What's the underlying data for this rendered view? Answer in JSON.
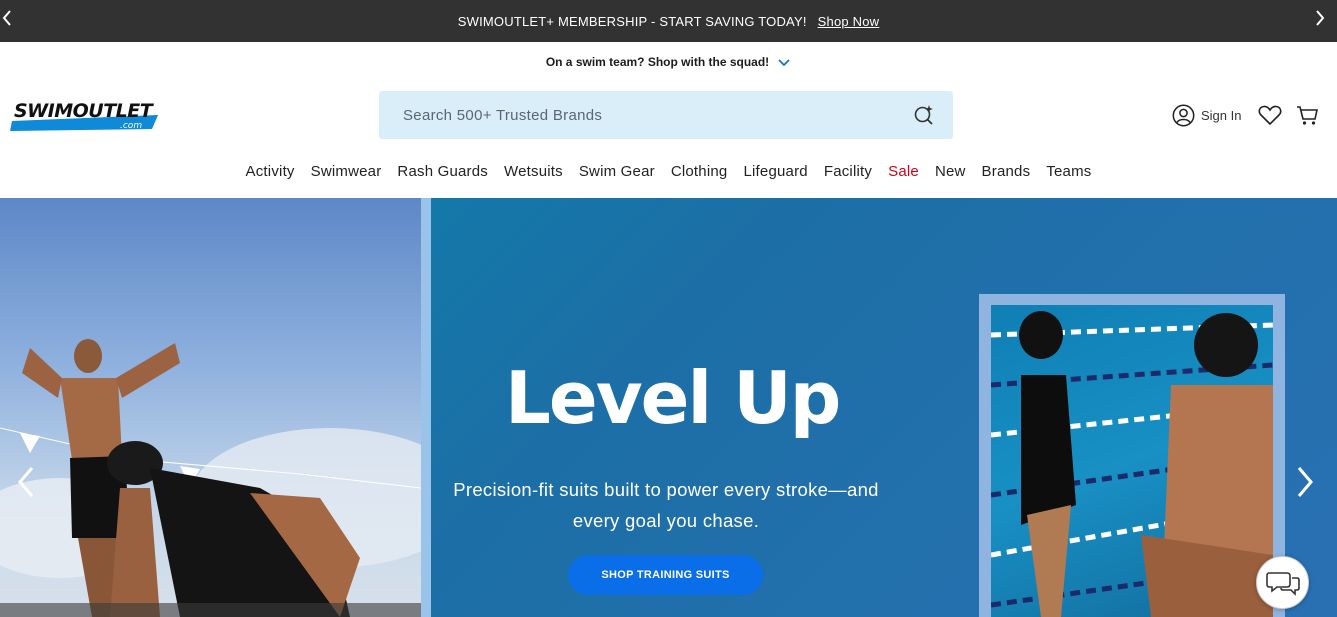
{
  "promo": {
    "message": "SWIMOUTLET+ MEMBERSHIP - START SAVING TODAY!",
    "link": "Shop Now",
    "prev_icon": "chevron-left-icon",
    "next_icon": "chevron-right-icon"
  },
  "team_bar": {
    "text": "On a swim team? Shop with the squad!",
    "icon": "chevron-down-icon",
    "accent": "#1a6fd6"
  },
  "header": {
    "logo_main": "SWIMOUTLET",
    "logo_sub": ".com",
    "search_placeholder": "Search 500+ Trusted Brands",
    "search_icon": "search-sparkle-icon",
    "sign_in": "Sign In",
    "account_icon": "user-icon",
    "wishlist_icon": "heart-icon",
    "cart_icon": "cart-icon"
  },
  "nav": {
    "items": [
      {
        "label": "Activity"
      },
      {
        "label": "Swimwear"
      },
      {
        "label": "Rash Guards"
      },
      {
        "label": "Wetsuits"
      },
      {
        "label": "Swim Gear"
      },
      {
        "label": "Clothing"
      },
      {
        "label": "Lifeguard"
      },
      {
        "label": "Facility"
      },
      {
        "label": "Sale"
      },
      {
        "label": "New"
      },
      {
        "label": "Brands"
      },
      {
        "label": "Teams"
      }
    ],
    "sale_color": "#d0021b"
  },
  "hero": {
    "title": "Level Up",
    "subtitle": "Precision-fit suits built to power every stroke—and every goal you chase.",
    "cta": "SHOP TRAINING SUITS",
    "cta_color": "#0a6ee8",
    "background": "#1c6fa6"
  },
  "chat": {
    "icon": "chat-bubbles-icon"
  }
}
